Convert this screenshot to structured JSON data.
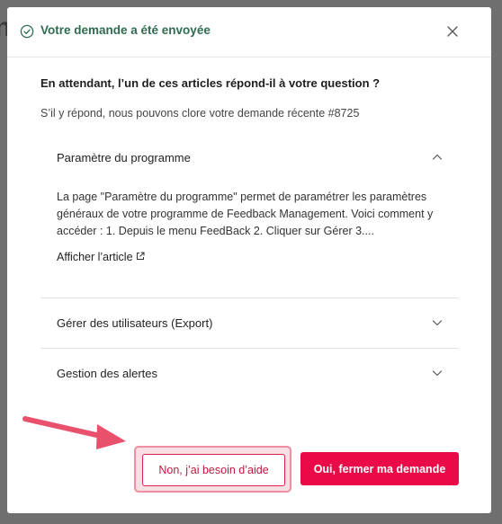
{
  "backdrop": {
    "glyph": "n"
  },
  "header": {
    "title": "Votre demande a été envoyée",
    "success_icon": "check-circle-icon",
    "close_icon": "close-icon",
    "accent_color": "#2f6b4f"
  },
  "main": {
    "question": "En attendant, l’un de ces articles répond-il à votre question ?",
    "subtext": "S’il y répond, nous pouvons clore votre demande récente #8725"
  },
  "articles": [
    {
      "title": "Paramètre du programme",
      "expanded": true,
      "excerpt": "La page \"Paramètre du programme\" permet de paramétrer les paramètres généraux de votre programme de Feedback Management. Voici comment y accéder : 1. Depuis le menu FeedBack 2. Cliquer sur Gérer 3....",
      "link_label": "Afficher l’article",
      "link_icon": "external-link-icon",
      "toggle_icon": "chevron-up-icon"
    },
    {
      "title": "Gérer des utilisateurs (Export)",
      "expanded": false,
      "toggle_icon": "chevron-down-icon"
    },
    {
      "title": "Gestion des alertes",
      "expanded": false,
      "toggle_icon": "chevron-down-icon"
    }
  ],
  "actions": {
    "secondary_label": "Non, j’ai besoin d’aide",
    "primary_label": "Oui, fermer ma demande",
    "primary_color": "#ea0a47",
    "highlight_color": "#ef8ea2"
  }
}
